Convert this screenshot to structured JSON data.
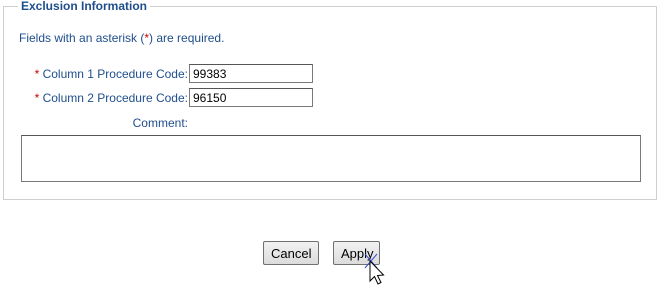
{
  "section": {
    "legend": "Exclusion Information",
    "required_note_prefix": "Fields with an asterisk (",
    "required_note_asterisk": "*",
    "required_note_suffix": ") are required."
  },
  "fields": {
    "column1": {
      "asterisk": "*",
      "label": "Column 1 Procedure Code:",
      "value": "99383"
    },
    "column2": {
      "asterisk": "*",
      "label": "Column 2 Procedure Code:",
      "value": "96150"
    },
    "comment": {
      "label": "Comment:",
      "value": ""
    }
  },
  "buttons": {
    "cancel_label": "Cancel",
    "apply_label": "Apply"
  },
  "colors": {
    "label_text": "#1f4e8c",
    "required_asterisk": "#cc0000"
  },
  "icons": {
    "cursor": "mouse-pointer-icon"
  }
}
